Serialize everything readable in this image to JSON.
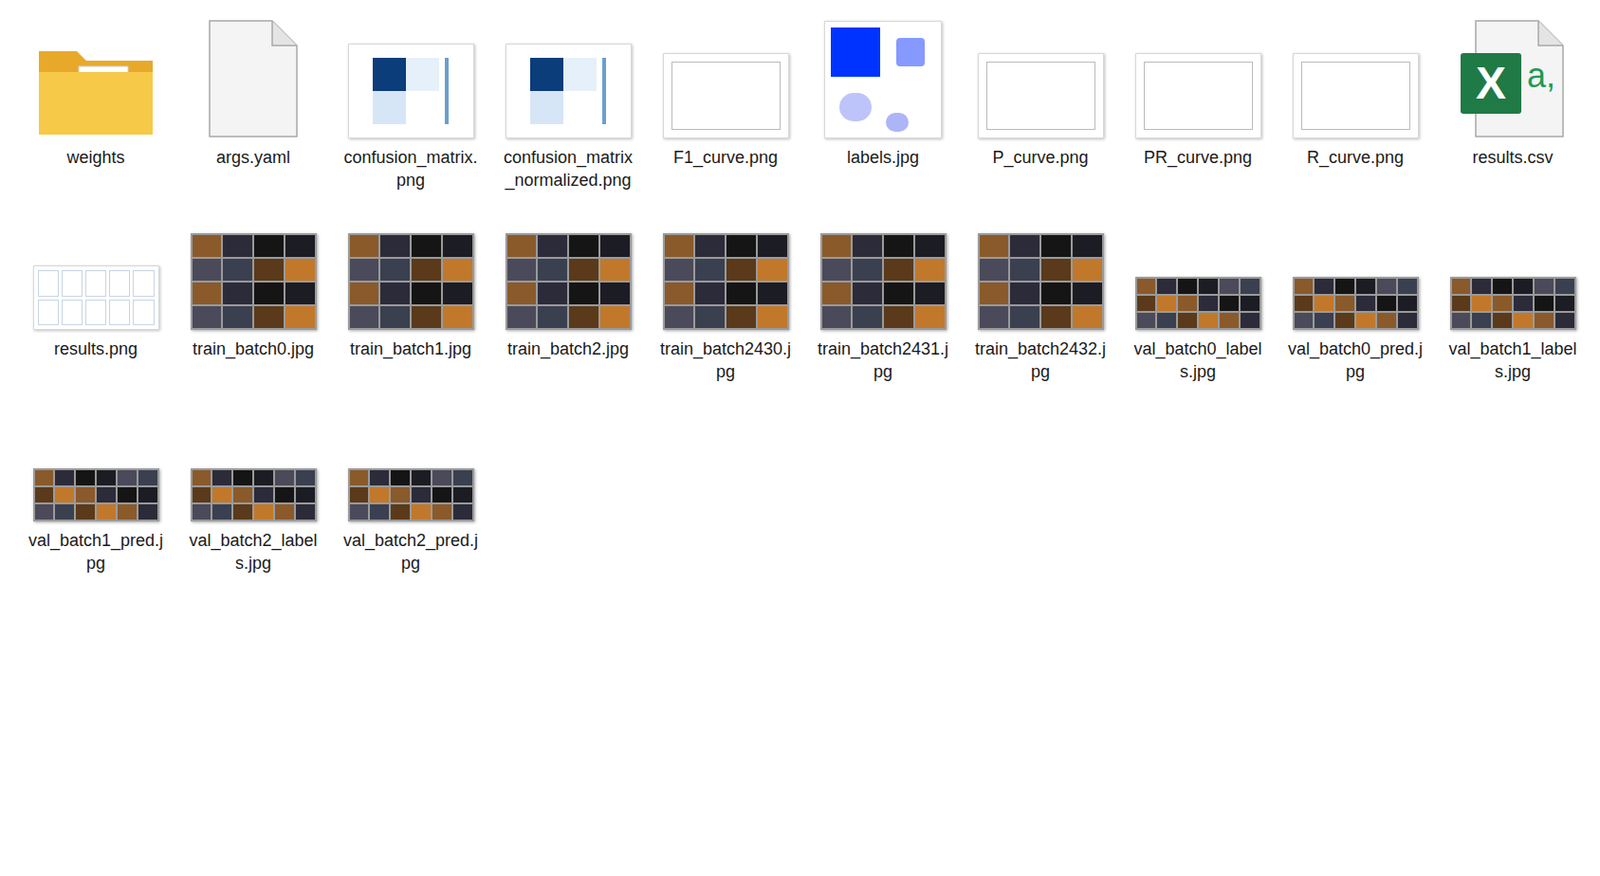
{
  "items": [
    {
      "name": "weights",
      "kind": "folder"
    },
    {
      "name": "args.yaml",
      "kind": "document"
    },
    {
      "name": "confusion_matrix.png",
      "kind": "matrix"
    },
    {
      "name": "confusion_matrix_normalized.png",
      "kind": "matrix"
    },
    {
      "name": "F1_curve.png",
      "kind": "chart"
    },
    {
      "name": "labels.jpg",
      "kind": "scatter"
    },
    {
      "name": "P_curve.png",
      "kind": "chart"
    },
    {
      "name": "PR_curve.png",
      "kind": "chart"
    },
    {
      "name": "R_curve.png",
      "kind": "chart"
    },
    {
      "name": "results.csv",
      "kind": "spreadsheet",
      "icon_glyphs": [
        "X",
        "a,"
      ]
    },
    {
      "name": "results.png",
      "kind": "chart-wide"
    },
    {
      "name": "train_batch0.jpg",
      "kind": "photo"
    },
    {
      "name": "train_batch1.jpg",
      "kind": "photo"
    },
    {
      "name": "train_batch2.jpg",
      "kind": "photo"
    },
    {
      "name": "train_batch2430.jpg",
      "kind": "photo"
    },
    {
      "name": "train_batch2431.jpg",
      "kind": "photo"
    },
    {
      "name": "train_batch2432.jpg",
      "kind": "photo"
    },
    {
      "name": "val_batch0_labels.jpg",
      "kind": "photo-wide"
    },
    {
      "name": "val_batch0_pred.jpg",
      "kind": "photo-wide"
    },
    {
      "name": "val_batch1_labels.jpg",
      "kind": "photo-wide"
    },
    {
      "name": "val_batch1_pred.jpg",
      "kind": "photo-wide"
    },
    {
      "name": "val_batch2_labels.jpg",
      "kind": "photo-wide"
    },
    {
      "name": "val_batch2_pred.jpg",
      "kind": "photo-wide"
    }
  ]
}
